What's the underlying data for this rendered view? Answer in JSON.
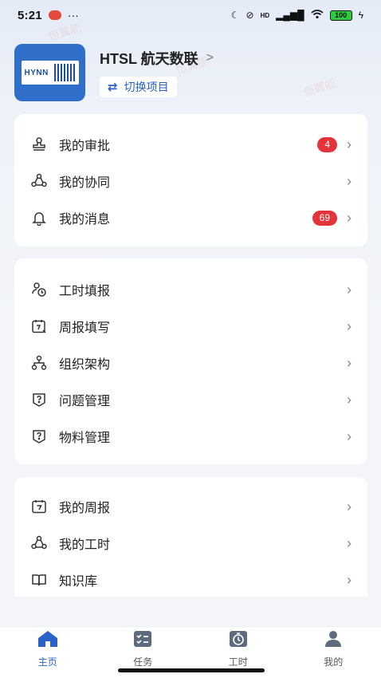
{
  "status_bar": {
    "time": "5:21",
    "dots": "···",
    "signal": "HD",
    "battery": "100"
  },
  "header": {
    "org_name": "HTSL 航天数联",
    "logo_text": "HYNN",
    "switch_label": "切换项目"
  },
  "group1": [
    {
      "label": "我的审批",
      "badge": "4",
      "icon": "stamp-icon"
    },
    {
      "label": "我的协同",
      "badge": null,
      "icon": "share-icon"
    },
    {
      "label": "我的消息",
      "badge": "69",
      "icon": "bell-icon"
    }
  ],
  "group2": [
    {
      "label": "工时填报",
      "icon": "clock-people-icon"
    },
    {
      "label": "周报填写",
      "icon": "calendar-edit-icon"
    },
    {
      "label": "组织架构",
      "icon": "org-chart-icon"
    },
    {
      "label": "问题管理",
      "icon": "question-shield-icon"
    },
    {
      "label": "物料管理",
      "icon": "question-box-icon"
    }
  ],
  "group3": [
    {
      "label": "我的周报",
      "icon": "calendar-icon"
    },
    {
      "label": "我的工时",
      "icon": "share-icon"
    },
    {
      "label": "知识库",
      "icon": "book-icon"
    }
  ],
  "watermark": "恒翼能",
  "tabs": [
    {
      "label": "主页",
      "icon": "home-icon",
      "active": true
    },
    {
      "label": "任务",
      "icon": "task-icon",
      "active": false
    },
    {
      "label": "工时",
      "icon": "timer-icon",
      "active": false
    },
    {
      "label": "我的",
      "icon": "user-icon",
      "active": false
    }
  ],
  "colors": {
    "accent": "#2a62c9",
    "badge": "#e5333b",
    "logo_bg": "#2f6ec9"
  }
}
